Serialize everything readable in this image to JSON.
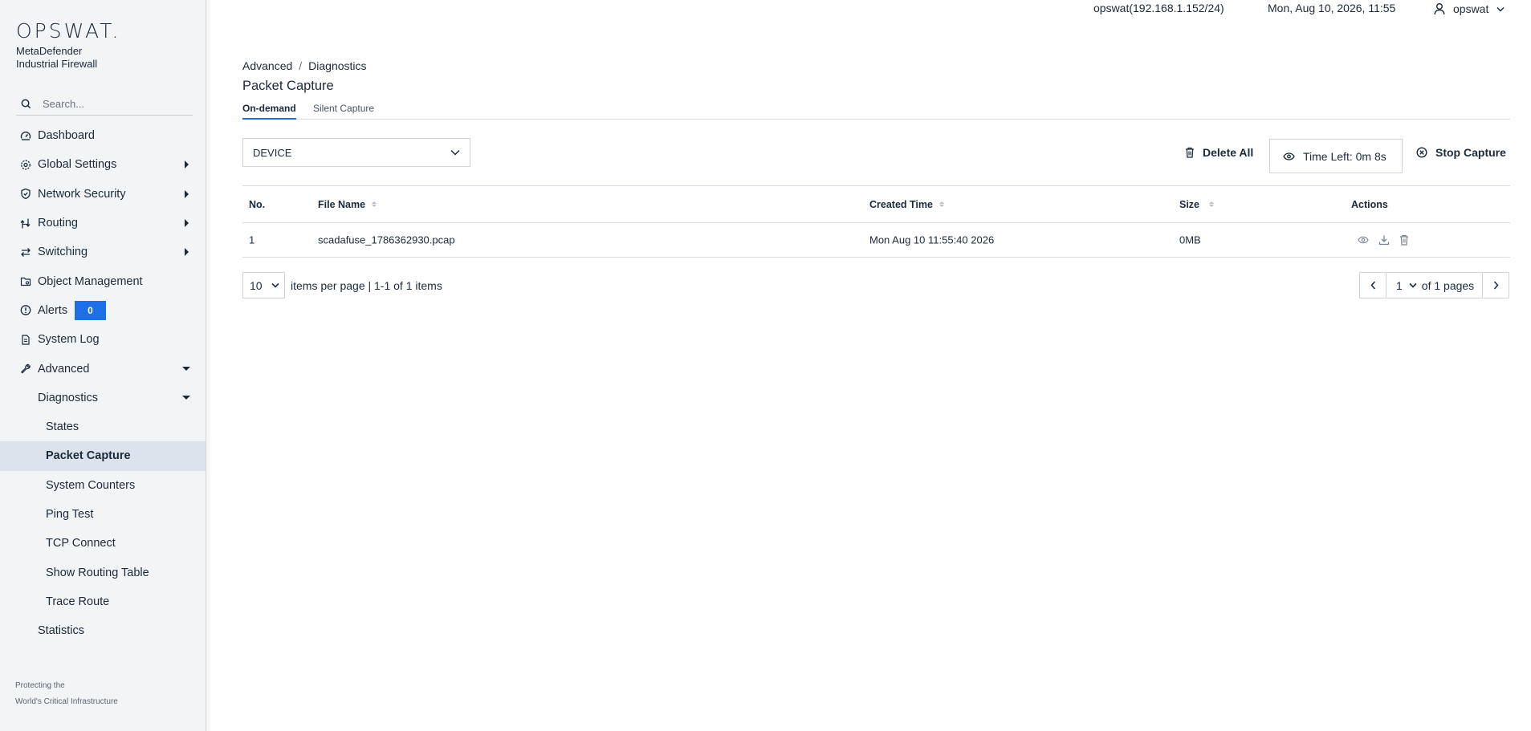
{
  "brand": {
    "logo": "OPSWAT.",
    "product_line1": "MetaDefender",
    "product_line2": "Industrial Firewall"
  },
  "search": {
    "placeholder": "Search..."
  },
  "sidebar": {
    "items": [
      {
        "label": "Dashboard",
        "icon": "dashboard-icon"
      },
      {
        "label": "Global Settings",
        "icon": "gear-icon"
      },
      {
        "label": "Network Security",
        "icon": "shield-icon"
      },
      {
        "label": "Routing",
        "icon": "routing-icon"
      },
      {
        "label": "Switching",
        "icon": "switch-arrows-icon"
      },
      {
        "label": "Object Management",
        "icon": "folder-settings-icon"
      },
      {
        "label": "Alerts",
        "icon": "alert-circle-icon",
        "badge": "0"
      },
      {
        "label": "System Log",
        "icon": "document-icon"
      },
      {
        "label": "Advanced",
        "icon": "wrench-icon"
      },
      {
        "label": "Diagnostics"
      },
      {
        "label": "States"
      },
      {
        "label": "Packet Capture"
      },
      {
        "label": "System Counters"
      },
      {
        "label": "Ping Test"
      },
      {
        "label": "TCP Connect"
      },
      {
        "label": "Show Routing Table"
      },
      {
        "label": "Trace Route"
      },
      {
        "label": "Statistics"
      }
    ],
    "footer_line1": "Protecting the",
    "footer_line2": "World's Critical Infrastructure"
  },
  "topbar": {
    "host": "opswat(192.168.1.152/24)",
    "datetime": "Mon, Aug 10, 2026, 11:55",
    "username": "opswat"
  },
  "breadcrumb": {
    "parent": "Advanced",
    "separator": "/",
    "current": "Diagnostics"
  },
  "page_title": "Packet Capture",
  "tabs": [
    {
      "label": "On-demand",
      "active": true
    },
    {
      "label": "Silent Capture",
      "active": false
    }
  ],
  "device_select": {
    "value": "DEVICE"
  },
  "toolbar": {
    "delete_all": "Delete All",
    "time_left": "Time Left: 0m 8s",
    "stop_capture": "Stop Capture"
  },
  "table": {
    "columns": [
      "No.",
      "File Name",
      "Created Time",
      "Size",
      "Actions"
    ],
    "rows": [
      {
        "no": "1",
        "file_name": "scadafuse_1786362930.pcap",
        "created": "Mon Aug 10 11:55:40 2026",
        "size": "0MB"
      }
    ]
  },
  "pagination": {
    "per_page": "10",
    "summary": "items per page | 1-1 of 1 items",
    "current_page": "1",
    "of_pages": "of 1 pages"
  },
  "colors": {
    "accent": "#1d6fe8",
    "active_nav_bg": "#dde3ec",
    "sidebar_bg": "#f3f4f6"
  }
}
